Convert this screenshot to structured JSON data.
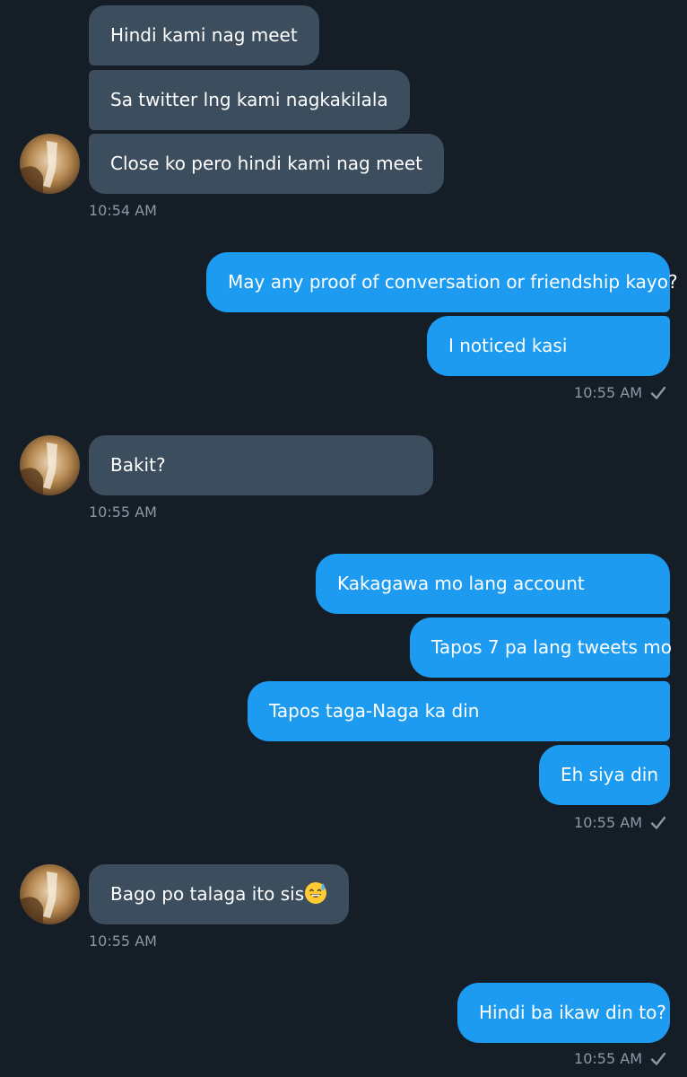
{
  "colors": {
    "background": "#151d27",
    "incoming_bubble": "#3c4d5e",
    "outgoing_bubble": "#1d9bf0",
    "timestamp": "#8b98a5"
  },
  "messages": {
    "g1": {
      "m1": "Hindi kami nag meet",
      "m2": "Sa twitter lng kami nagkakilala",
      "m3": "Close ko pero hindi kami nag meet",
      "time": "10:54 AM"
    },
    "g2": {
      "m1": "May any proof of conversation or friendship kayo?",
      "m2": "I noticed kasi",
      "time": "10:55 AM"
    },
    "g3": {
      "m1": "Bakit?",
      "time": "10:55 AM"
    },
    "g4": {
      "m1": "Kakagawa mo lang account",
      "m2": "Tapos 7 pa lang tweets mo",
      "m3": "Tapos taga-Naga ka din",
      "m4": "Eh siya din",
      "time": "10:55 AM"
    },
    "g5": {
      "m1": "Bago po talaga ito sis",
      "emoji": "grinning-face-with-sweat-emoji",
      "time": "10:55 AM"
    },
    "g6": {
      "m1": "Hindi ba ikaw din to?",
      "time": "10:55 AM"
    }
  }
}
